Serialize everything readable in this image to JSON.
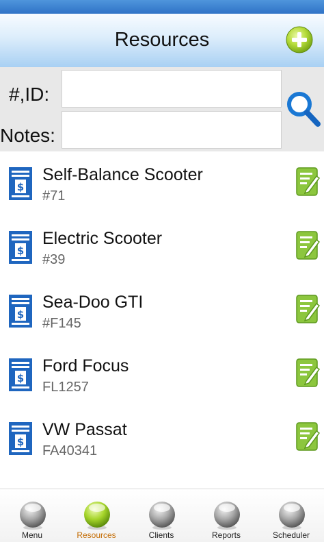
{
  "header": {
    "title": "Resources"
  },
  "search": {
    "id_label": "#,ID:",
    "id_value": "",
    "notes_label": "Notes:",
    "notes_value": ""
  },
  "resources": [
    {
      "name": "Self-Balance Scooter",
      "code": "#71"
    },
    {
      "name": "Electric Scooter",
      "code": "#39"
    },
    {
      "name": "Sea-Doo GTI",
      "code": "#F145"
    },
    {
      "name": "Ford Focus",
      "code": "FL1257"
    },
    {
      "name": "VW Passat",
      "code": "FA40341"
    }
  ],
  "nav": {
    "items": [
      {
        "label": "Menu",
        "active": false
      },
      {
        "label": "Resources",
        "active": true
      },
      {
        "label": "Clients",
        "active": false
      },
      {
        "label": "Reports",
        "active": false
      },
      {
        "label": "Scheduler",
        "active": false
      }
    ]
  },
  "colors": {
    "accent_blue": "#1f66bf",
    "accent_green": "#7cbf1f",
    "active_label": "#c46d05"
  }
}
